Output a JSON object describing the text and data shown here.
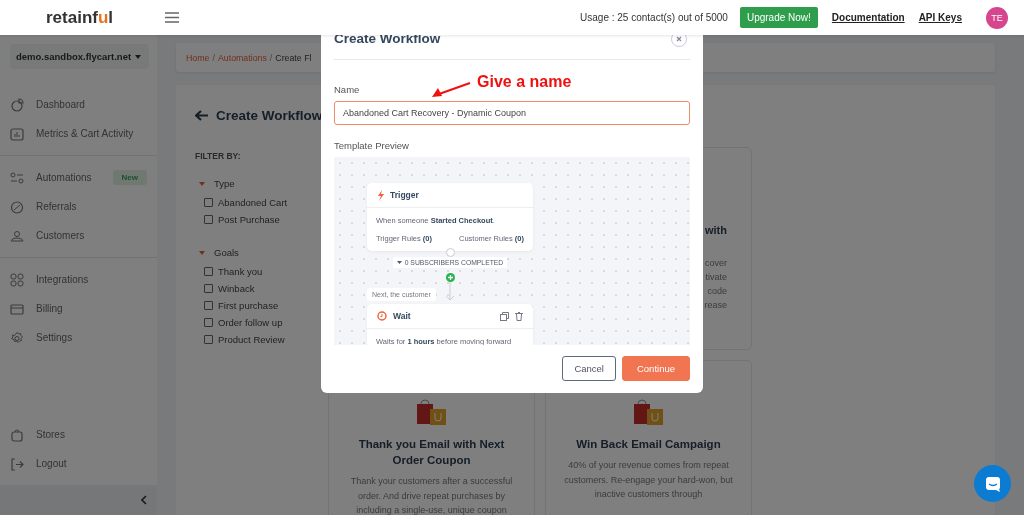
{
  "header": {
    "logo": {
      "start": "retainf",
      "accent": "u",
      "end": "l"
    },
    "usage": "Usage : 25 contact(s) out of 5000",
    "upgrade_button": "Upgrade Now!",
    "links": [
      "Documentation",
      "API Keys"
    ],
    "avatar": "TE"
  },
  "sidebar": {
    "store": "demo.sandbox.flycart.net",
    "groups": [
      [
        {
          "label": "Dashboard"
        },
        {
          "label": "Metrics & Cart Activity"
        }
      ],
      [
        {
          "label": "Automations",
          "badge": "New"
        },
        {
          "label": "Referrals"
        },
        {
          "label": "Customers"
        }
      ],
      [
        {
          "label": "Integrations"
        },
        {
          "label": "Billing"
        },
        {
          "label": "Settings"
        }
      ]
    ],
    "bottom": [
      {
        "label": "Stores"
      },
      {
        "label": "Logout"
      }
    ]
  },
  "breadcrumb": {
    "separator": "/",
    "items": [
      "Home",
      "Automations",
      "Create Fl"
    ]
  },
  "page_title": "Create Workflow",
  "filter": {
    "title": "FILTER BY:",
    "groups": [
      {
        "label": "Type",
        "expanded": true,
        "options": [
          {
            "label": "Abandoned Cart",
            "checked": false
          },
          {
            "label": "Post Purchase",
            "checked": false
          }
        ]
      },
      {
        "label": "Goals",
        "expanded": true,
        "options": [
          {
            "label": "Thank you",
            "checked": false
          },
          {
            "label": "Winback",
            "checked": false
          },
          {
            "label": "First purchase",
            "checked": false
          },
          {
            "label": "Order follow up",
            "checked": false
          },
          {
            "label": "Product Review",
            "checked": false
          }
        ]
      }
    ]
  },
  "cards": [
    {
      "kind": "hidden"
    },
    {
      "kind": "fragment",
      "title": "with",
      "lines": [
        "cover",
        "tivate",
        "code",
        "rease"
      ]
    },
    {
      "kind": "full",
      "title": "Thank you Email with Next Order Coupon",
      "description": "Thank your customers after a successful order. And drive repeat purchases by including a single-use, unique coupon"
    },
    {
      "kind": "full",
      "title": "Win Back Email Campaign",
      "description": "40% of your revenue comes from repeat customers. Re-engage your hard-won, but inactive customers through"
    }
  ],
  "modal": {
    "title": "Create Workflow",
    "name_label": "Name",
    "name_value": "Abandoned Cart Recovery - Dynamic Coupon",
    "annotation": "Give a name",
    "preview_label": "Template Preview",
    "preview": {
      "trigger": {
        "title": "Trigger",
        "text": "When someone **Started Checkout**.",
        "rules": [
          "Trigger Rules **(0)**",
          "Customer Rules **(0)**"
        ]
      },
      "completed": "0 SUBSCRIBERS COMPLETED",
      "next_label": "Next, the customer",
      "wait": {
        "title": "Wait",
        "text": "Waits for **1 hours** before moving forward"
      }
    },
    "buttons": [
      {
        "label": "Cancel",
        "kind": "secondary"
      },
      {
        "label": "Continue",
        "kind": "primary"
      }
    ]
  }
}
